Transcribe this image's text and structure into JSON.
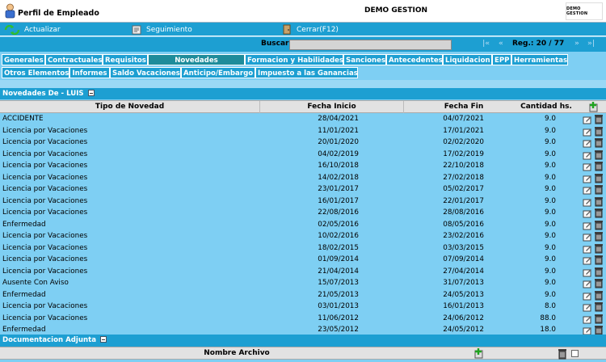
{
  "app": {
    "title": "Perfil de Empleado",
    "company": "DEMO GESTION",
    "logo_text": "DEMO GESTION"
  },
  "toolbar": {
    "refresh_label": "Actualizar",
    "tracking_label": "Seguimiento",
    "close_label": "Cerrar(F12)"
  },
  "search": {
    "label": "Buscar",
    "value": "",
    "first": "|«",
    "prev": "«",
    "reg": "Reg.: 20 / 77",
    "next": "»",
    "last": "»|"
  },
  "tabs_row1": [
    "Generales",
    "Contractuales",
    "Requisitos",
    "Novedades",
    "Formacion y Habilidades",
    "Sanciones",
    "Antecedentes",
    "Liquidacion",
    "EPP",
    "Herramientas"
  ],
  "tabs_row2": [
    "Otros Elementos",
    "Informes",
    "Saldo Vacaciones",
    "Anticipo/Embargo",
    "Impuesto a las Ganancias"
  ],
  "active_tab": "Novedades",
  "novedades": {
    "section_title": "Novedades De - LUIS",
    "columns": {
      "tipo": "Tipo de Novedad",
      "inicio": "Fecha Inicio",
      "fin": "Fecha Fin",
      "cantidad": "Cantidad hs."
    },
    "rows": [
      {
        "tipo": "ACCIDENTE",
        "inicio": "28/04/2021",
        "fin": "04/07/2021",
        "cantidad": "9.0"
      },
      {
        "tipo": "Licencia por Vacaciones",
        "inicio": "11/01/2021",
        "fin": "17/01/2021",
        "cantidad": "9.0"
      },
      {
        "tipo": "Licencia por Vacaciones",
        "inicio": "20/01/2020",
        "fin": "02/02/2020",
        "cantidad": "9.0"
      },
      {
        "tipo": "Licencia por Vacaciones",
        "inicio": "04/02/2019",
        "fin": "17/02/2019",
        "cantidad": "9.0"
      },
      {
        "tipo": "Licencia por Vacaciones",
        "inicio": "16/10/2018",
        "fin": "22/10/2018",
        "cantidad": "9.0"
      },
      {
        "tipo": "Licencia por Vacaciones",
        "inicio": "14/02/2018",
        "fin": "27/02/2018",
        "cantidad": "9.0"
      },
      {
        "tipo": "Licencia por Vacaciones",
        "inicio": "23/01/2017",
        "fin": "05/02/2017",
        "cantidad": "9.0"
      },
      {
        "tipo": "Licencia por Vacaciones",
        "inicio": "16/01/2017",
        "fin": "22/01/2017",
        "cantidad": "9.0"
      },
      {
        "tipo": "Licencia por Vacaciones",
        "inicio": "22/08/2016",
        "fin": "28/08/2016",
        "cantidad": "9.0"
      },
      {
        "tipo": "Enfermedad",
        "inicio": "02/05/2016",
        "fin": "08/05/2016",
        "cantidad": "9.0"
      },
      {
        "tipo": "Licencia por Vacaciones",
        "inicio": "10/02/2016",
        "fin": "23/02/2016",
        "cantidad": "9.0"
      },
      {
        "tipo": "Licencia por Vacaciones",
        "inicio": "18/02/2015",
        "fin": "03/03/2015",
        "cantidad": "9.0"
      },
      {
        "tipo": "Licencia por Vacaciones",
        "inicio": "01/09/2014",
        "fin": "07/09/2014",
        "cantidad": "9.0"
      },
      {
        "tipo": "Licencia por Vacaciones",
        "inicio": "21/04/2014",
        "fin": "27/04/2014",
        "cantidad": "9.0"
      },
      {
        "tipo": "Ausente Con Aviso",
        "inicio": "15/07/2013",
        "fin": "31/07/2013",
        "cantidad": "9.0"
      },
      {
        "tipo": "Enfermedad",
        "inicio": "21/05/2013",
        "fin": "24/05/2013",
        "cantidad": "9.0"
      },
      {
        "tipo": "Licencia por Vacaciones",
        "inicio": "03/01/2013",
        "fin": "16/01/2013",
        "cantidad": "8.0"
      },
      {
        "tipo": "Licencia por Vacaciones",
        "inicio": "11/06/2012",
        "fin": "24/06/2012",
        "cantidad": "88.0"
      },
      {
        "tipo": "Enfermedad",
        "inicio": "23/05/2012",
        "fin": "24/05/2012",
        "cantidad": "18.0"
      }
    ]
  },
  "documentacion": {
    "section_title": "Documentacion Adjunta",
    "column_name": "Nombre Archivo"
  },
  "colors": {
    "toolbar_bg": "#1d9fd2",
    "page_bg": "#7ecff3",
    "active_tab": "#1e8c9b"
  }
}
